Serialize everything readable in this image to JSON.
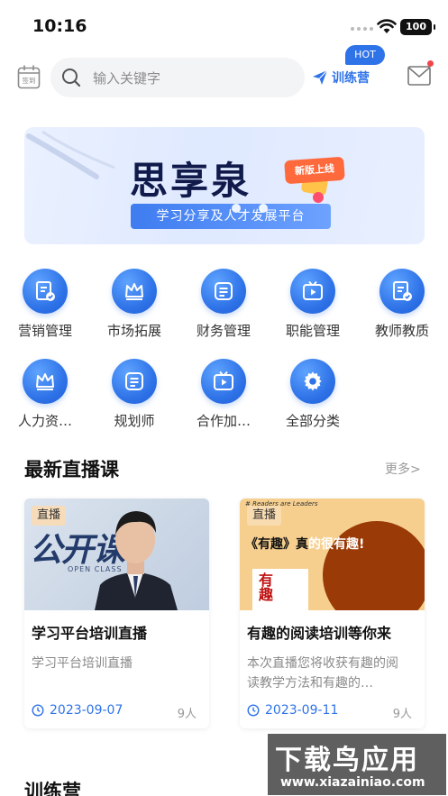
{
  "status_bar": {
    "time": "10:16",
    "battery": "100"
  },
  "header": {
    "checkin_label": "签到",
    "search_placeholder": "输入关键字",
    "training_label": "训练营",
    "hot_badge": "HOT"
  },
  "banner": {
    "title": "思享泉",
    "subtitle": "学习分享及人才发展平台",
    "tag": "新版上线"
  },
  "categories": [
    {
      "label": "营销管理",
      "icon": "document-check-icon"
    },
    {
      "label": "市场拓展",
      "icon": "crown-icon"
    },
    {
      "label": "财务管理",
      "icon": "list-icon"
    },
    {
      "label": "职能管理",
      "icon": "play-screen-icon"
    },
    {
      "label": "教师教质",
      "icon": "document-check-icon"
    },
    {
      "label": "人力资…",
      "icon": "crown-icon"
    },
    {
      "label": "规划师",
      "icon": "list-icon"
    },
    {
      "label": "合作加…",
      "icon": "play-screen-icon"
    },
    {
      "label": "全部分类",
      "icon": "gear-icon"
    }
  ],
  "live_section": {
    "title": "最新直播课",
    "more": "更多>",
    "cards": [
      {
        "badge": "直播",
        "thumb_text": "公开课",
        "thumb_sub": "OPEN CLASS",
        "title": "学习平台培训直播",
        "desc": "学习平台培训直播",
        "date": "2023-09-07",
        "count": "9人"
      },
      {
        "badge": "直播",
        "thumb_small": "# Readers are Leaders",
        "thumb_head_a": "《有趣》真",
        "thumb_head_b": "的很有趣!",
        "thumb_book": "有趣",
        "title": "有趣的阅读培训等你来",
        "desc": "本次直播您将收获有趣的阅读教学方法和有趣的…",
        "date": "2023-09-11",
        "count": "9人"
      }
    ]
  },
  "next_section": {
    "title": "训练营"
  },
  "watermark": {
    "text": "下载鸟应用",
    "url": "www.xiazainiao.com"
  },
  "colors": {
    "accent": "#2f73e8",
    "notification": "#f0464b"
  }
}
